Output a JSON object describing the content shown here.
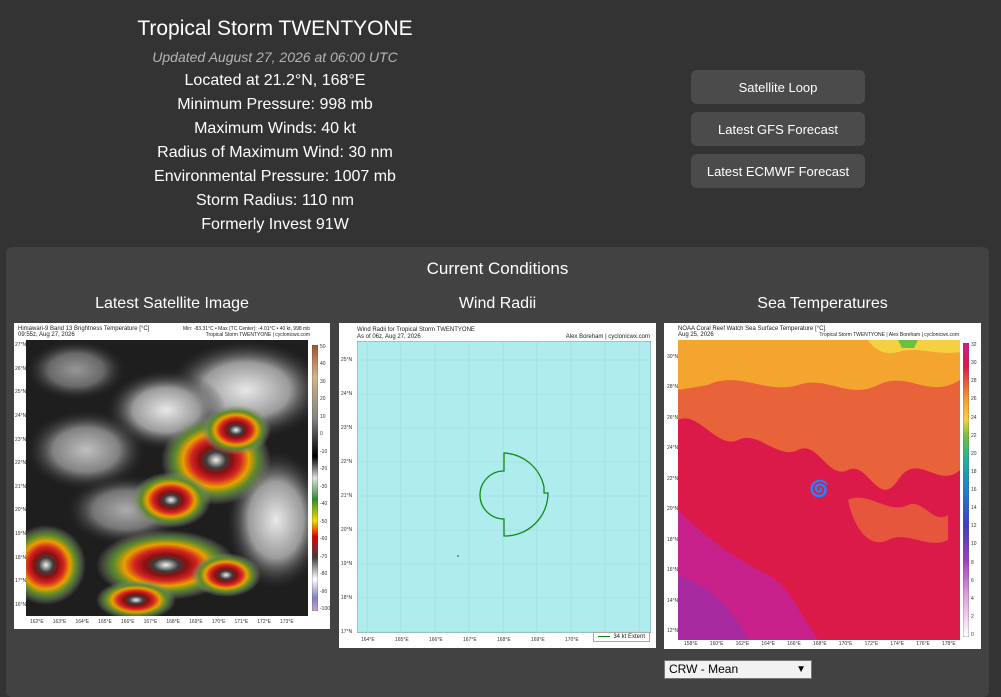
{
  "storm": {
    "title": "Tropical Storm TWENTYONE",
    "updated": "Updated August 27, 2026 at 06:00 UTC",
    "details": [
      "Located at 21.2°N, 168°E",
      "Minimum Pressure: 998 mb",
      "Maximum Winds: 40 kt",
      "Radius of Maximum Wind: 30 nm",
      "Environmental Pressure: 1007 mb",
      "Storm Radius: 110 nm",
      "Formerly Invest 91W"
    ]
  },
  "buttons": {
    "satellite_loop": "Satellite Loop",
    "gfs_forecast": "Latest GFS Forecast",
    "ecmwf_forecast": "Latest ECMWF Forecast"
  },
  "conditions": {
    "title": "Current Conditions",
    "satellite": {
      "title": "Latest Satellite Image",
      "header_left_1": "Himawari-9 Band 13 Brightness Temperature [°C]",
      "header_left_2": "09:55z, Aug 27, 2026",
      "header_right_1": "Min: -83.31°C • Max (TC Center): -4.01°C • 40 kt, 998 mb",
      "header_right_2": "Tropical Storm TWENTYONE | cyclonicwx.com",
      "lat_ticks": [
        "27°N",
        "26°N",
        "25°N",
        "24°N",
        "23°N",
        "22°N",
        "21°N",
        "20°N",
        "19°N",
        "18°N",
        "17°N",
        "16°N"
      ],
      "lon_ticks": [
        "162°E",
        "163°E",
        "164°E",
        "165°E",
        "166°E",
        "167°E",
        "168°E",
        "169°E",
        "170°E",
        "171°E",
        "172°E",
        "173°E"
      ],
      "colorbar_ticks": [
        "50",
        "40",
        "30",
        "20",
        "10",
        "0",
        "-10",
        "-20",
        "-30",
        "-40",
        "-50",
        "-60",
        "-70",
        "-80",
        "-90",
        "-100"
      ]
    },
    "wind": {
      "title": "Wind Radii",
      "header_left_1": "Wind Radii for Tropical Storm TWENTYONE",
      "header_left_2": "As of 06z, Aug 27, 2026",
      "header_right": "Alex Boreham | cyclonicwx.com",
      "lat_ticks": [
        "25°N",
        "24°N",
        "23°N",
        "22°N",
        "21°N",
        "20°N",
        "19°N",
        "18°N",
        "17°N"
      ],
      "lon_ticks": [
        "164°E",
        "165°E",
        "166°E",
        "167°E",
        "168°E",
        "169°E",
        "170°E",
        "171°E",
        "172°E"
      ],
      "legend": "34 kt Extent"
    },
    "sst": {
      "title": "Sea Temperatures",
      "header_left_1": "NOAA Coral Reef Watch Sea Surface Temperature [°C]",
      "header_left_2": "Aug 25, 2026",
      "header_right": "Tropical Storm TWENTYONE | Alex Boreham | cyclonicwx.com",
      "lat_ticks": [
        "30°N",
        "28°N",
        "26°N",
        "24°N",
        "22°N",
        "20°N",
        "18°N",
        "16°N",
        "14°N",
        "12°N"
      ],
      "lon_ticks": [
        "158°E",
        "160°E",
        "162°E",
        "164°E",
        "166°E",
        "168°E",
        "170°E",
        "172°E",
        "174°E",
        "176°E",
        "178°E"
      ],
      "colorbar_ticks": [
        "32",
        "30",
        "28",
        "26",
        "24",
        "22",
        "20",
        "18",
        "16",
        "14",
        "12",
        "10",
        "8",
        "6",
        "4",
        "2",
        "0"
      ],
      "select_value": "CRW - Mean"
    }
  }
}
